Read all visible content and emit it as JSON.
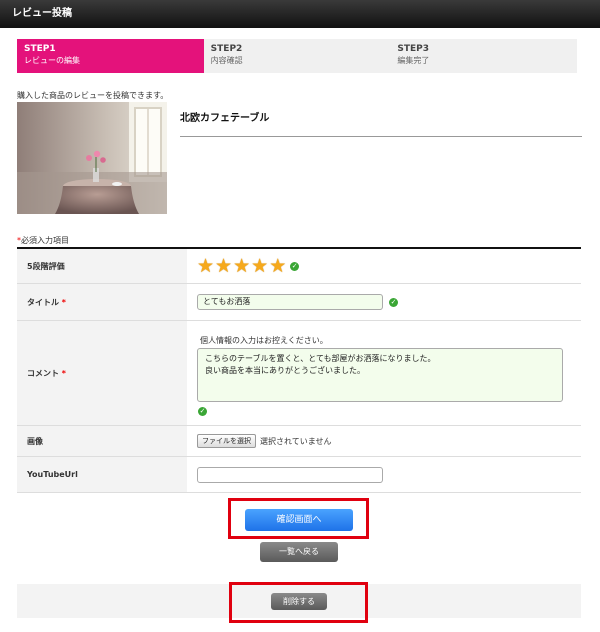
{
  "header": {
    "title": "レビュー投稿"
  },
  "steps": [
    {
      "num": "STEP1",
      "label": "レビューの編集",
      "active": true
    },
    {
      "num": "STEP2",
      "label": "内容確認",
      "active": false
    },
    {
      "num": "STEP3",
      "label": "編集完了",
      "active": false
    }
  ],
  "intro": "購入した商品のレビューを投稿できます。",
  "product": {
    "name": "北欧カフェテーブル"
  },
  "form": {
    "required_note": "必須入力項目",
    "required_mark": "*",
    "rating": {
      "label": "5段階評価",
      "value": 5,
      "max": 5
    },
    "title": {
      "label": "タイトル",
      "value": "とてもお洒落"
    },
    "comment": {
      "label": "コメント",
      "hint": "個人情報の入力はお控えください。",
      "lines": [
        "こちらのテーブルを置くと、とても部屋がお洒落になりました。",
        "良い商品を本当にありがとうございました。"
      ]
    },
    "image": {
      "label": "画像",
      "button": "ファイルを選択",
      "status": "選択されていません"
    },
    "youtube": {
      "label": "YouTubeUrl",
      "value": ""
    }
  },
  "actions": {
    "confirm": "確認画面へ",
    "back": "一覧へ戻る",
    "delete": "削除する"
  },
  "colors": {
    "accent": "#e4127b",
    "primary": "#1e72e8",
    "highlight": "#e0000f"
  }
}
